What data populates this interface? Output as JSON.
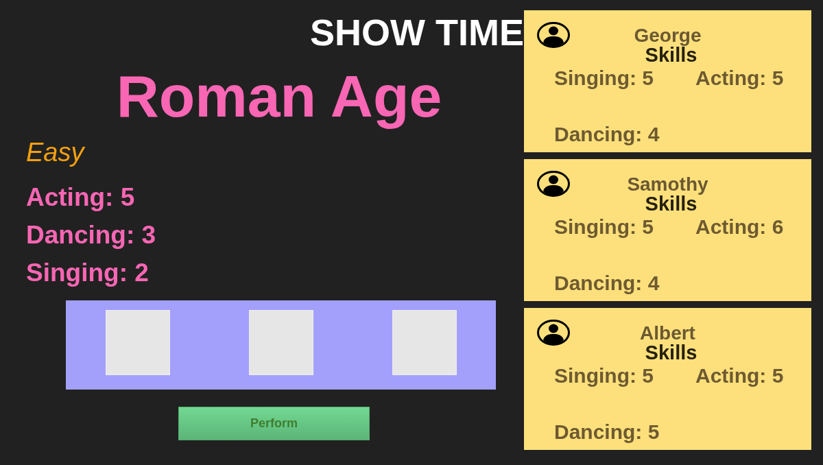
{
  "title": "SHOW TIME",
  "era": {
    "name": "Roman Age",
    "difficulty": "Easy",
    "requirements": [
      "Acting: 5",
      "Dancing: 3",
      "Singing: 2"
    ]
  },
  "slots": [
    {
      "kind": "empty"
    },
    {
      "kind": "empty"
    },
    {
      "kind": "empty"
    }
  ],
  "perform_button": "Perform",
  "performers": [
    {
      "name": "George",
      "skills_heading": "Skills",
      "skills": [
        "Singing: 5",
        "Acting: 5",
        "Dancing: 4"
      ]
    },
    {
      "name": "Samothy",
      "skills_heading": "Skills",
      "skills": [
        "Singing: 5",
        "Acting: 6",
        "Dancing: 4"
      ]
    },
    {
      "name": "Albert",
      "skills_heading": "Skills",
      "skills": [
        "Singing: 5",
        "Acting: 5",
        "Dancing: 5"
      ]
    }
  ]
}
